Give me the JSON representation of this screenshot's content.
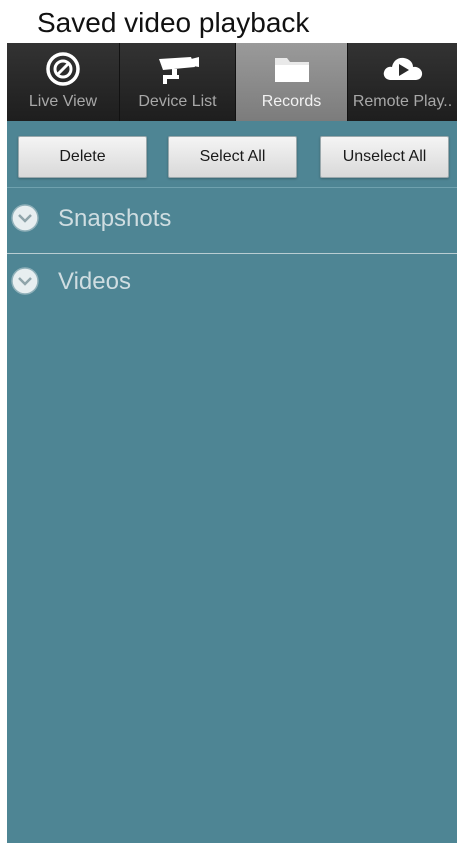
{
  "caption": "Saved video playback",
  "tabs": [
    {
      "label": "Live View",
      "icon": "live-view-icon"
    },
    {
      "label": "Device List",
      "icon": "camera-icon"
    },
    {
      "label": "Records",
      "icon": "folder-icon",
      "active": true
    },
    {
      "label": "Remote Play..",
      "icon": "cloud-play-icon"
    }
  ],
  "toolbar": {
    "delete_label": "Delete",
    "select_all_label": "Select All",
    "unselect_all_label": "Unselect All"
  },
  "groups": [
    {
      "label": "Snapshots",
      "icon": "chevron-down-circle-icon"
    },
    {
      "label": "Videos",
      "icon": "chevron-down-circle-icon"
    }
  ],
  "colors": {
    "content_background": "#4e8594",
    "tabbar_background": "#2a2a2a",
    "active_tab": "#8c8c8c"
  }
}
